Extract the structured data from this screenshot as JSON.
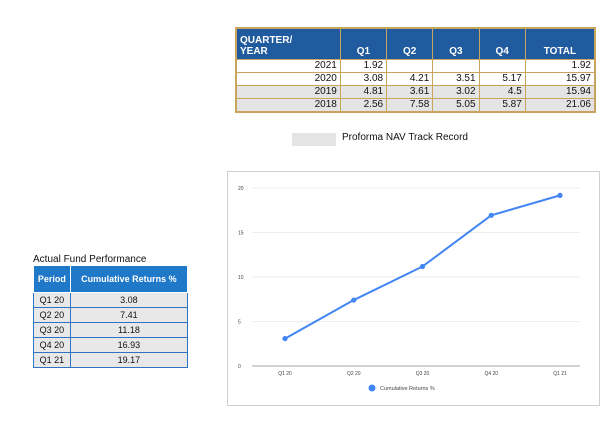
{
  "quarter_table": {
    "headers": [
      "QUARTER/\nYEAR",
      "Q1",
      "Q2",
      "Q3",
      "Q4",
      "TOTAL"
    ],
    "rows": [
      [
        "2021",
        "1.92",
        "",
        "",
        "",
        "1.92"
      ],
      [
        "2020",
        "3.08",
        "4.21",
        "3.51",
        "5.17",
        "15.97"
      ],
      [
        "2019",
        "4.81",
        "3.61",
        "3.02",
        "4.5",
        "15.94"
      ],
      [
        "2018",
        "2.56",
        "7.58",
        "5.05",
        "5.87",
        "21.06"
      ]
    ],
    "shaded_rows": [
      2,
      3
    ]
  },
  "proforma_legend": {
    "label": "Proforma NAV Track Record"
  },
  "performance": {
    "title": "Actual Fund Performance",
    "headers": [
      "Period",
      "Cumulative Returns %"
    ],
    "rows": [
      [
        "Q1 20",
        "3.08"
      ],
      [
        "Q2 20",
        "7.41"
      ],
      [
        "Q3 20",
        "11.18"
      ],
      [
        "Q4 20",
        "16.93"
      ],
      [
        "Q1 21",
        "19.17"
      ]
    ]
  },
  "colors": {
    "header_blue": "#1f5b9e",
    "series_blue": "#4285f4",
    "border_gold": "#c9a45c"
  },
  "chart_data": {
    "type": "line",
    "x": [
      "Q1 20",
      "Q2 20",
      "Q3 20",
      "Q4 20",
      "Q1 21"
    ],
    "series": [
      {
        "name": "Cumulative Returns %",
        "values": [
          3.08,
          7.41,
          11.18,
          16.93,
          19.17
        ]
      }
    ],
    "yticks": [
      0,
      5,
      10,
      15,
      20
    ],
    "ylim": [
      0,
      20
    ],
    "grid": true,
    "legend": "bottom"
  }
}
